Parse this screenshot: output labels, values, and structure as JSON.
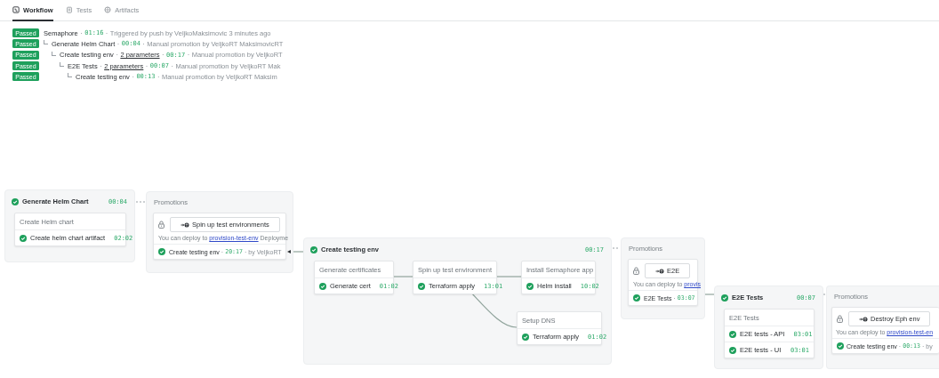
{
  "tabs": [
    {
      "label": "Workflow",
      "selected": true
    },
    {
      "label": "Tests",
      "selected": false
    },
    {
      "label": "Artifacts",
      "selected": false
    }
  ],
  "history": [
    {
      "status": "Passed",
      "parts": [
        {
          "kind": "name",
          "text": "Semaphore"
        },
        {
          "kind": "sep",
          "text": "·"
        },
        {
          "kind": "duration",
          "text": "01:16"
        },
        {
          "kind": "sep",
          "text": "·"
        },
        {
          "kind": "text",
          "text": "Triggered by push by VeljkoMaksimovic 3 minutes ago"
        }
      ],
      "children": [
        {
          "status": "Passed",
          "parts": [
            {
              "kind": "name",
              "text": "Generate Helm Chart"
            },
            {
              "kind": "sep",
              "text": "·"
            },
            {
              "kind": "duration",
              "text": "00:04"
            },
            {
              "kind": "sep",
              "text": "·"
            },
            {
              "kind": "text",
              "text": "Manual promotion by VeljkoRT MaksimovicRT"
            }
          ],
          "children": [
            {
              "status": "Passed",
              "parts": [
                {
                  "kind": "name",
                  "text": "Create testing env"
                },
                {
                  "kind": "sep",
                  "text": "·"
                },
                {
                  "kind": "link",
                  "text": "2 parameters"
                },
                {
                  "kind": "sep",
                  "text": "·"
                },
                {
                  "kind": "duration",
                  "text": "00:17"
                },
                {
                  "kind": "sep",
                  "text": "·"
                },
                {
                  "kind": "text",
                  "text": "Manual promotion by VeljkoRT"
                }
              ],
              "children": [
                {
                  "status": "Passed",
                  "parts": [
                    {
                      "kind": "name",
                      "text": "E2E Tests"
                    },
                    {
                      "kind": "sep",
                      "text": "·"
                    },
                    {
                      "kind": "link",
                      "text": "2 parameters"
                    },
                    {
                      "kind": "sep",
                      "text": "·"
                    },
                    {
                      "kind": "duration",
                      "text": "00:07"
                    },
                    {
                      "kind": "sep",
                      "text": "·"
                    },
                    {
                      "kind": "text",
                      "text": "Manual promotion by VeljkoRT Mak"
                    }
                  ],
                  "children": [
                    {
                      "status": "Passed",
                      "parts": [
                        {
                          "kind": "name",
                          "text": "Create testing env"
                        },
                        {
                          "kind": "sep",
                          "text": "·"
                        },
                        {
                          "kind": "duration",
                          "text": "00:13"
                        },
                        {
                          "kind": "sep",
                          "text": "·"
                        },
                        {
                          "kind": "text",
                          "text": "Manual promotion by VeljkoRT Maksim"
                        }
                      ]
                    }
                  ]
                }
              ]
            }
          ]
        }
      ]
    }
  ],
  "diagram": [
    {
      "kind": "pipeline",
      "title": "Generate Helm Chart",
      "duration": "00:04",
      "passed": true,
      "groups": [
        {
          "name": "Create Helm chart",
          "jobs": [
            {
              "name": "Create helm chart artifact",
              "duration": "02:02",
              "passed": true
            }
          ]
        }
      ]
    },
    {
      "kind": "promotions",
      "heading": "Promotions",
      "button": "Spin up test environments",
      "note": [
        {
          "kind": "text",
          "text": "You can deploy to"
        },
        {
          "kind": "link",
          "text": "provision-test-env"
        },
        {
          "kind": "text",
          "text": "Deployme"
        }
      ],
      "run": {
        "passed": true,
        "pointer": true,
        "parts": [
          {
            "kind": "name",
            "text": "Create testing env"
          },
          {
            "kind": "sep",
            "text": "·"
          },
          {
            "kind": "duration",
            "text": "20:17"
          },
          {
            "kind": "sep",
            "text": "·"
          },
          {
            "kind": "text",
            "text": "by VeljkoRT"
          }
        ]
      }
    },
    {
      "kind": "pipeline",
      "title": "Create testing env",
      "duration": "00:17",
      "passed": true,
      "groups": [
        {
          "name": "Generate certificates",
          "jobs": [
            {
              "name": "Generate cert",
              "duration": "01:02",
              "passed": true
            }
          ]
        },
        {
          "name": "Spin up test environment",
          "jobs": [
            {
              "name": "Terraform apply",
              "duration": "13:01",
              "passed": true
            }
          ]
        },
        {
          "name": "Install Semaphore app",
          "jobs": [
            {
              "name": "Helm install",
              "duration": "10:02",
              "passed": true
            }
          ]
        },
        {
          "name": "Setup DNS",
          "jobs": [
            {
              "name": "Terraform apply",
              "duration": "01:02",
              "passed": true
            }
          ]
        }
      ]
    },
    {
      "kind": "promotions",
      "heading": "Promotions",
      "button": "E2E",
      "note": [
        {
          "kind": "text",
          "text": "You can deploy to"
        },
        {
          "kind": "link",
          "text": "provis"
        }
      ],
      "run": {
        "passed": true,
        "parts": [
          {
            "kind": "name",
            "text": "E2E Tests"
          },
          {
            "kind": "sep",
            "text": "·"
          },
          {
            "kind": "duration",
            "text": "03:07"
          }
        ]
      }
    },
    {
      "kind": "pipeline",
      "title": "E2E Tests",
      "duration": "00:07",
      "passed": true,
      "groups": [
        {
          "name": "E2E Tests",
          "jobs": [
            {
              "name": "E2E tests - API",
              "duration": "03:01",
              "passed": true
            },
            {
              "name": "E2E tests - UI",
              "duration": "03:01",
              "passed": true
            }
          ]
        }
      ]
    },
    {
      "kind": "promotions",
      "heading": "Promotions",
      "button": "Destroy Eph env",
      "note": [
        {
          "kind": "text",
          "text": "You can deploy to"
        },
        {
          "kind": "link",
          "text": "provision-test-en"
        }
      ],
      "run": {
        "passed": true,
        "parts": [
          {
            "kind": "name",
            "text": "Create testing env"
          },
          {
            "kind": "sep",
            "text": "·"
          },
          {
            "kind": "duration",
            "text": "00:13"
          },
          {
            "kind": "sep",
            "text": "·"
          },
          {
            "kind": "text",
            "text": "by"
          }
        ]
      }
    }
  ]
}
